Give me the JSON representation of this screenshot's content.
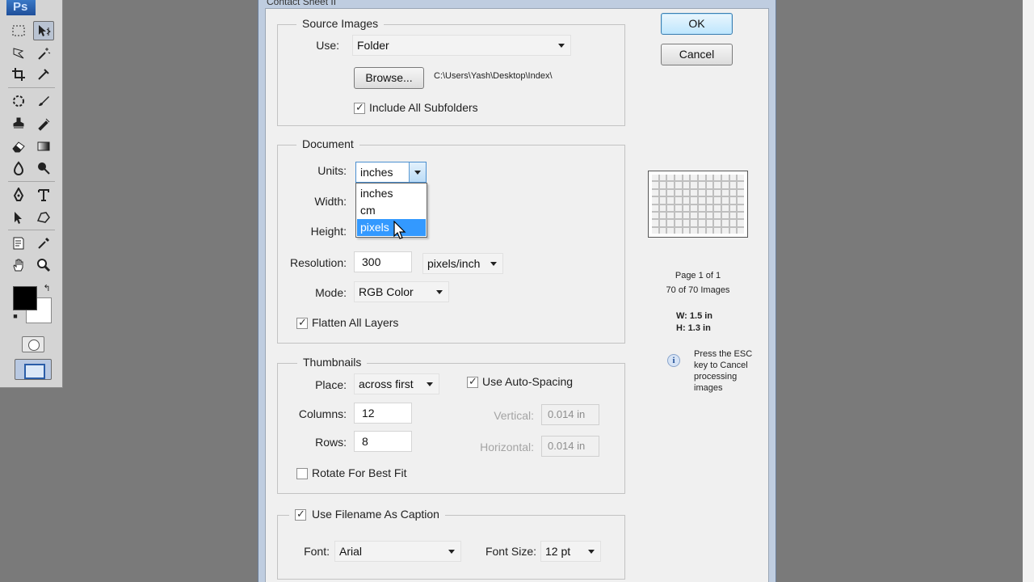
{
  "app": {
    "logo": "Ps"
  },
  "dialog": {
    "title": "Contact Sheet II"
  },
  "buttons": {
    "ok": "OK",
    "cancel": "Cancel",
    "browse": "Browse..."
  },
  "source": {
    "group_title": "Source Images",
    "use_label": "Use:",
    "use_value": "Folder",
    "path": "C:\\Users\\Yash\\Desktop\\Index\\",
    "include_subfolders_label": "Include All Subfolders",
    "include_subfolders_checked": true
  },
  "document": {
    "group_title": "Document",
    "units_label": "Units:",
    "units_value": "inches",
    "units_options": [
      "inches",
      "cm",
      "pixels"
    ],
    "units_highlighted": "pixels",
    "width_label": "Width:",
    "height_label": "Height:",
    "resolution_label": "Resolution:",
    "resolution_value": "300",
    "resolution_unit": "pixels/inch",
    "mode_label": "Mode:",
    "mode_value": "RGB Color",
    "flatten_label": "Flatten All Layers",
    "flatten_checked": true
  },
  "thumbnails": {
    "group_title": "Thumbnails",
    "place_label": "Place:",
    "place_value": "across first",
    "auto_spacing_label": "Use Auto-Spacing",
    "auto_spacing_checked": true,
    "columns_label": "Columns:",
    "columns_value": "12",
    "rows_label": "Rows:",
    "rows_value": "8",
    "vertical_label": "Vertical:",
    "vertical_value": "0.014 in",
    "horizontal_label": "Horizontal:",
    "horizontal_value": "0.014 in",
    "rotate_label": "Rotate For Best Fit",
    "rotate_checked": false
  },
  "caption": {
    "use_filename_label": "Use Filename As Caption",
    "use_filename_checked": true,
    "font_label": "Font:",
    "font_value": "Arial",
    "font_size_label": "Font Size:",
    "font_size_value": "12 pt"
  },
  "preview": {
    "columns": 12,
    "rows": 8,
    "page_info": "Page 1 of 1",
    "images_info": "70 of 70 Images",
    "width_info": "W: 1.5 in",
    "height_info": "H: 1.3 in",
    "esc_message": "Press the ESC key to Cancel processing images"
  },
  "colors": {
    "foreground": "#000000",
    "background": "#ffffff",
    "highlight": "#3399ff"
  }
}
